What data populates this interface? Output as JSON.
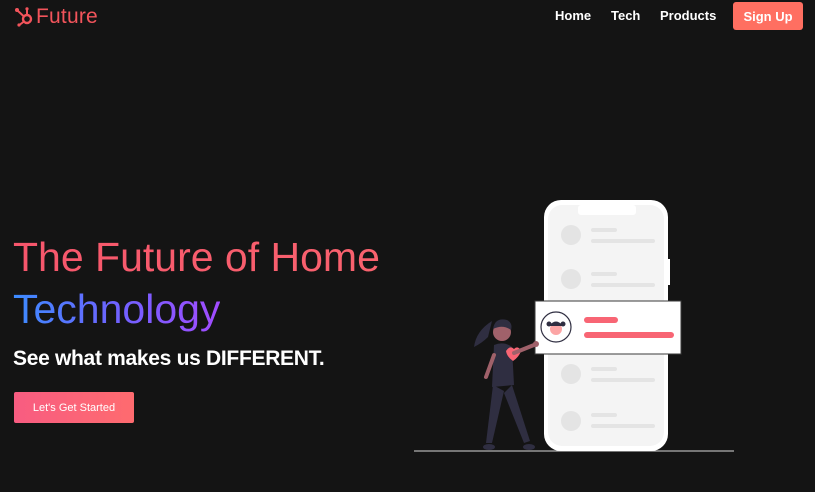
{
  "brand": {
    "name": "Future",
    "color": "#f2545b",
    "icon": "hub-icon"
  },
  "nav": {
    "items": [
      "Home",
      "Tech",
      "Products"
    ]
  },
  "signup": {
    "label": "Sign Up",
    "color": "#ff6f61"
  },
  "hero": {
    "headline_line1": "The Future of Home",
    "headline_line2": "Technology",
    "subheadline": "See what makes us DIFFERENT.",
    "cta_label": "Let's Get Started"
  },
  "colors": {
    "background": "#141414",
    "accent": "#f86574",
    "gradient_blue": "#3c8cff",
    "gradient_purple": "#a24cff"
  },
  "illustration": {
    "name": "woman-with-phone-illustration"
  }
}
